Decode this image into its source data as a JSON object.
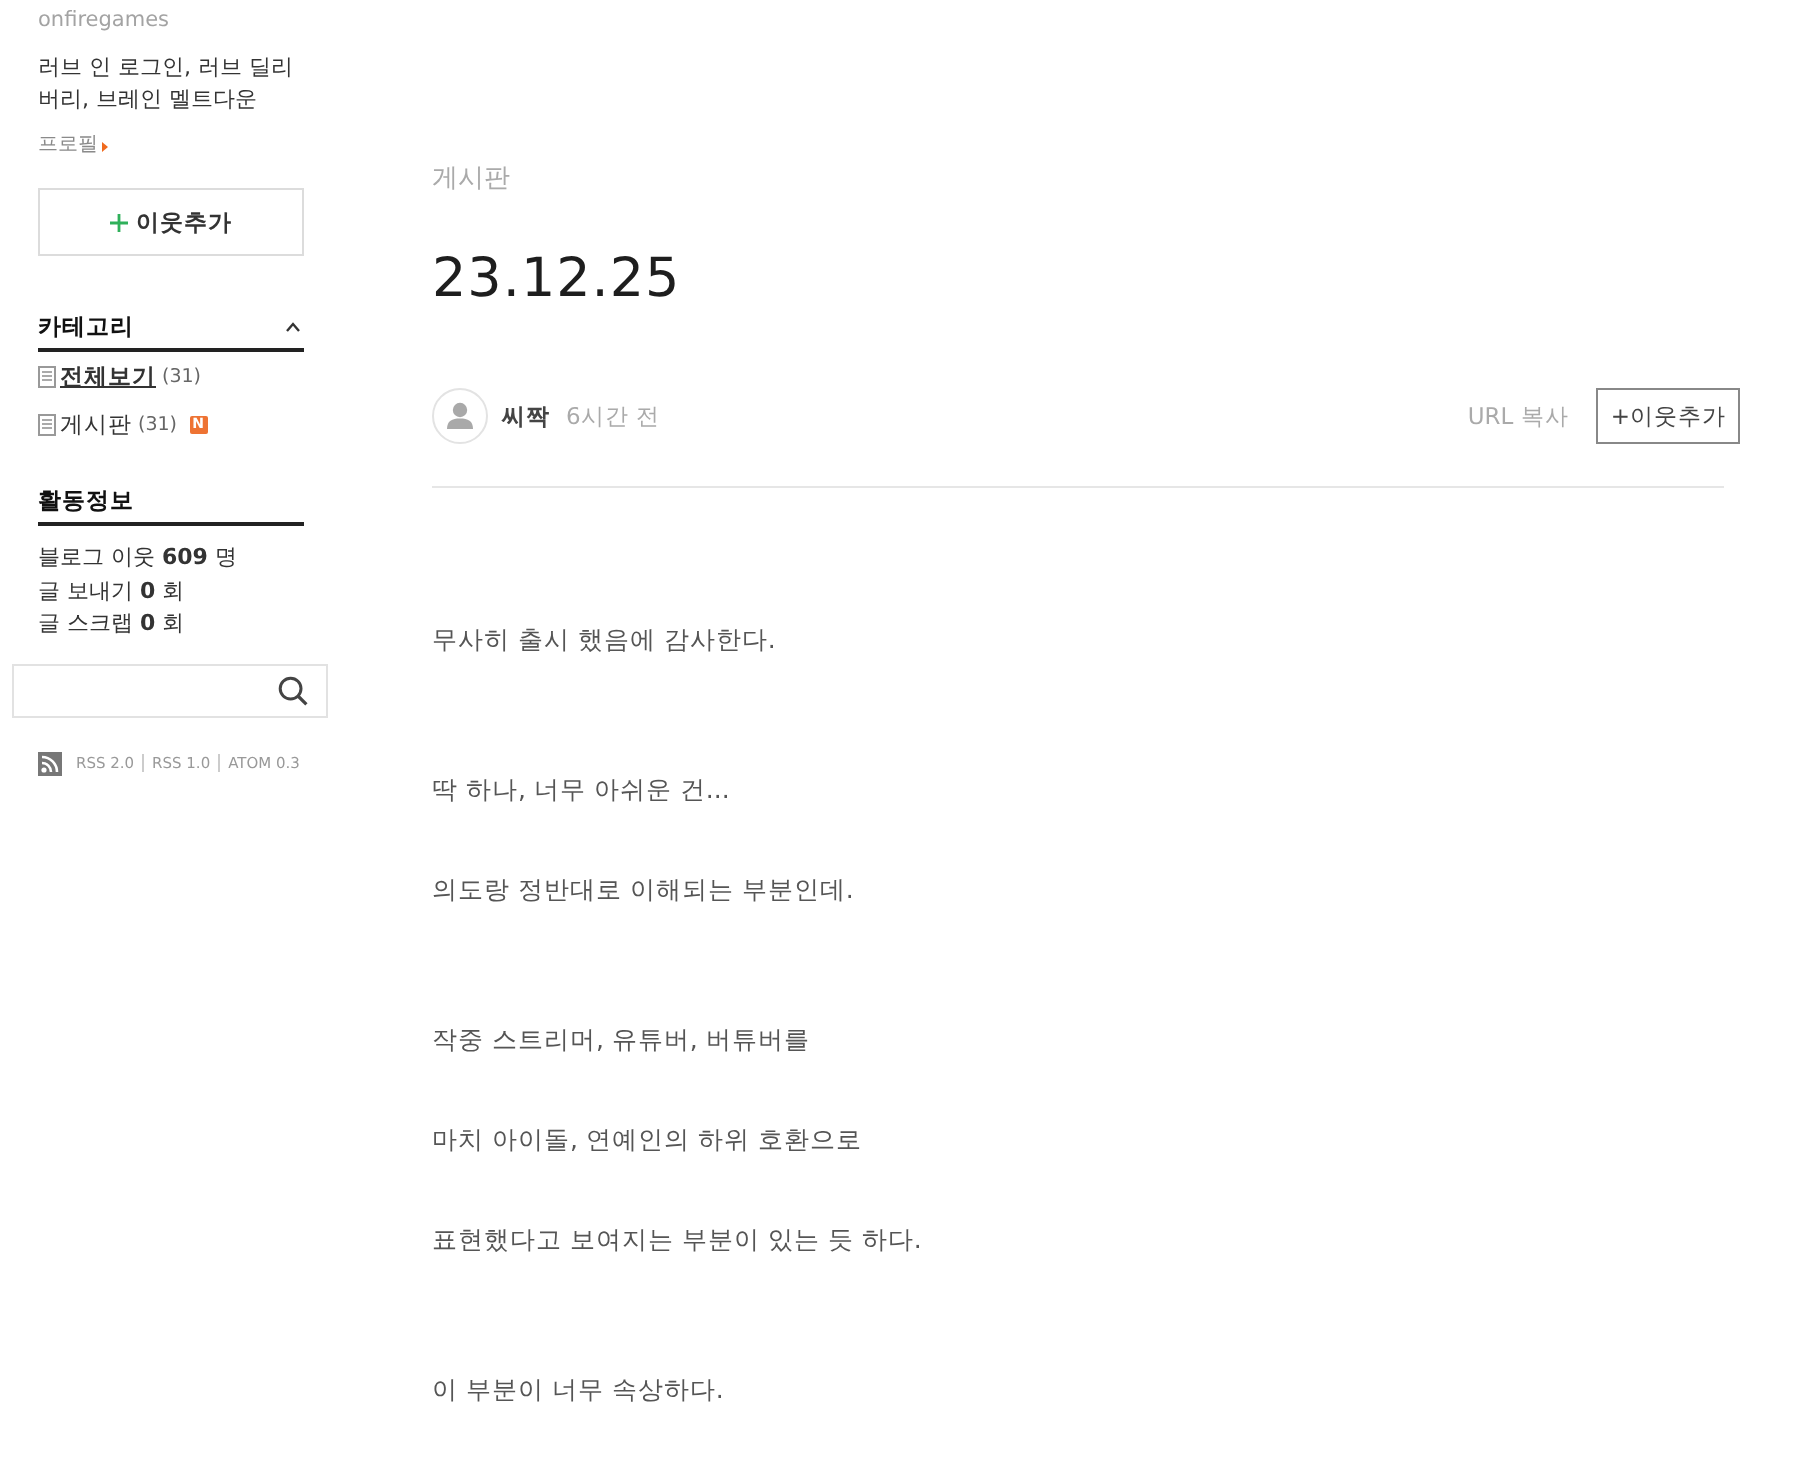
{
  "sidebar": {
    "blog_id": "onfiregames",
    "description": "러브 인 로그인, 러브 딜리버리, 브레인 멜트다운",
    "profile_link": "프로필",
    "add_neighbor_button": "이웃추가",
    "category": {
      "title": "카테고리",
      "expanded": true,
      "items": [
        {
          "label": "전체보기",
          "count": "(31)",
          "selected": true
        },
        {
          "label": "게시판",
          "count": "(31)",
          "selected": false,
          "badge": "N"
        }
      ]
    },
    "activity": {
      "title": "활동정보",
      "stats": [
        "블로그 이웃 **609** 명",
        "글 보내기 **0** 회",
        "글 스크랩 **0** 회"
      ]
    },
    "feeds": [
      "RSS 2.0",
      "RSS 1.0",
      "ATOM 0.3"
    ]
  },
  "post": {
    "category": "게시판",
    "title": "23.12.25",
    "author": "씨짝",
    "time": "6시간 전",
    "url_copy": "URL 복사",
    "add_neighbor_button": "+이웃추가",
    "body_sections": [
      [
        "무사히 출시 했음에 감사한다."
      ],
      [
        "딱 하나, 너무 아쉬운 건...",
        "의도랑 정반대로 이해되는 부분인데."
      ],
      [
        "작중 스트리머, 유튜버, 버튜버를",
        "마치 아이돌, 연예인의 하위 호환으로",
        "표현했다고 보여지는 부분이 있는 듯 하다."
      ],
      [
        "이 부분이 너무 속상하다."
      ]
    ]
  }
}
